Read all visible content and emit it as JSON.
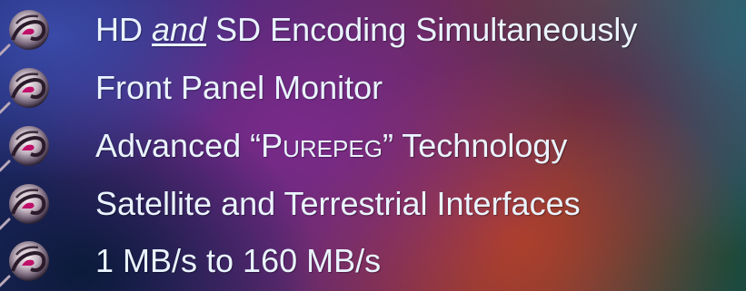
{
  "features": {
    "item1": {
      "pre": "HD ",
      "emphasis": "and",
      "post": " SD Encoding Simultaneously"
    },
    "item2": {
      "text": "Front Panel Monitor"
    },
    "item3": {
      "pre": "Advanced “P",
      "smallcaps1": "UREPEG",
      "post": "” Technology"
    },
    "item4": {
      "text": "Satellite and Terrestrial Interfaces"
    },
    "item5": {
      "text": "1 MB/s to 160 MB/s"
    }
  },
  "bullet_icon": "swirl-bullet-icon"
}
